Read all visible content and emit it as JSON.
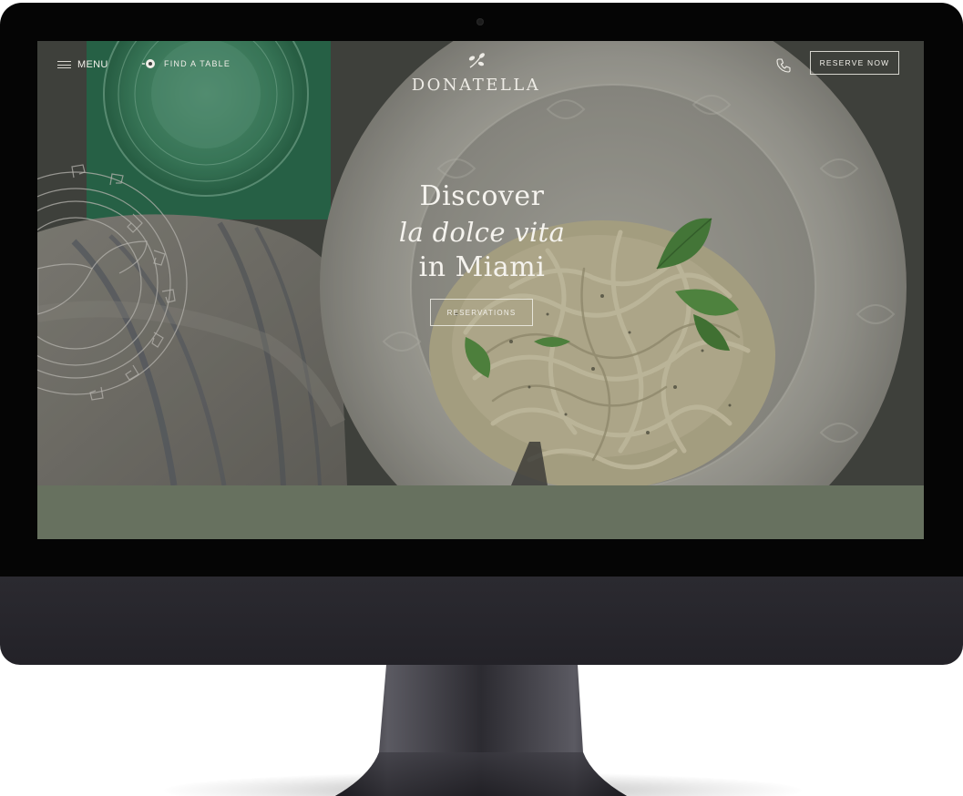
{
  "nav": {
    "menu_label": "MENU",
    "find_table_label": "FIND A TABLE",
    "reserve_label": "RESERVE NOW"
  },
  "brand": {
    "name": "DONATELLA"
  },
  "hero": {
    "line1": "Discover",
    "line2": "la dolce vita",
    "line3": "in Miami",
    "cta_label": "RESERVATIONS"
  },
  "icons": {
    "menu": "hamburger-icon",
    "find_table": "location-dot-icon",
    "logo": "sprig-icon",
    "phone": "phone-icon",
    "decor": "greek-key-medallion"
  },
  "colors": {
    "band": "#67715f",
    "text_light": "#f4f2ec",
    "glass_green": "#2f7a55",
    "bezel": "#050505",
    "chin": "#2b2a30"
  }
}
